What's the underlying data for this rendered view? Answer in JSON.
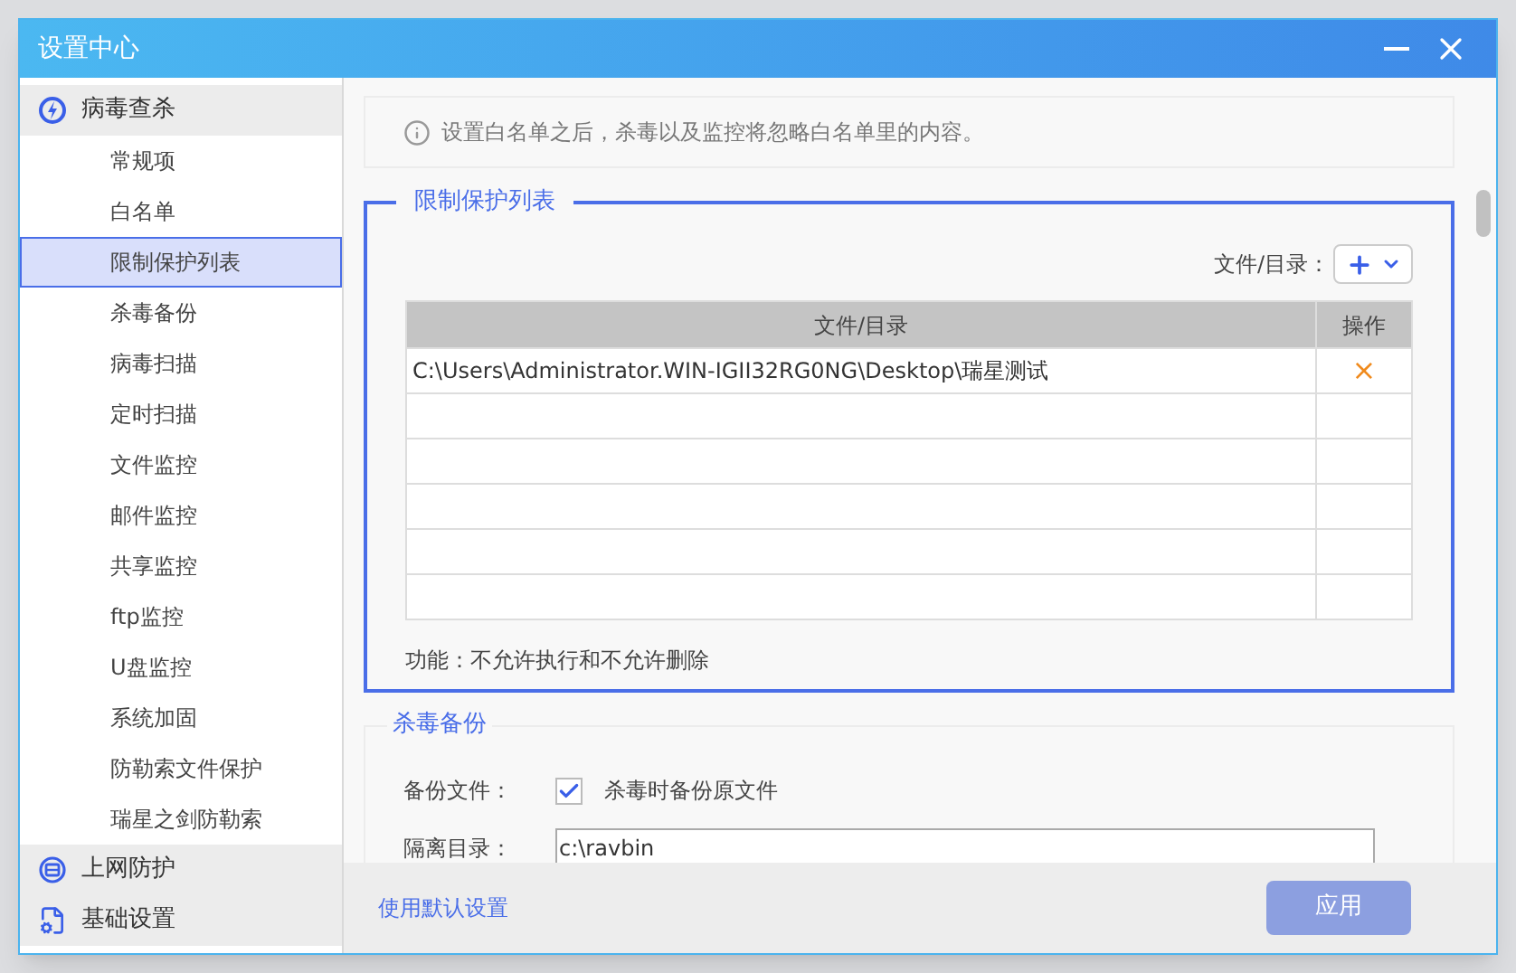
{
  "window": {
    "title": "设置中心"
  },
  "sidebar": {
    "groups": [
      {
        "label": "病毒查杀",
        "items": [
          {
            "label": "常规项",
            "selected": false
          },
          {
            "label": "白名单",
            "selected": false
          },
          {
            "label": "限制保护列表",
            "selected": true
          },
          {
            "label": "杀毒备份",
            "selected": false
          },
          {
            "label": "病毒扫描",
            "selected": false
          },
          {
            "label": "定时扫描",
            "selected": false
          },
          {
            "label": "文件监控",
            "selected": false
          },
          {
            "label": "邮件监控",
            "selected": false
          },
          {
            "label": "共享监控",
            "selected": false
          },
          {
            "label": "ftp监控",
            "selected": false
          },
          {
            "label": "U盘监控",
            "selected": false
          },
          {
            "label": "系统加固",
            "selected": false
          },
          {
            "label": "防勒索文件保护",
            "selected": false
          },
          {
            "label": "瑞星之剑防勒索",
            "selected": false
          }
        ]
      },
      {
        "label": "上网防护"
      },
      {
        "label": "基础设置"
      }
    ]
  },
  "notice": "设置白名单之后，杀毒以及监控将忽略白名单里的内容。",
  "protect_list": {
    "title": "限制保护列表",
    "add_label": "文件/目录：",
    "table": {
      "columns": [
        "文件/目录",
        "操作"
      ],
      "rows": [
        {
          "path": "C:\\Users\\Administrator.WIN-IGII32RG0NG\\Desktop\\瑞星测试",
          "action": "×"
        }
      ]
    },
    "note": "功能：不允许执行和不允许删除"
  },
  "backup": {
    "title": "杀毒备份",
    "rows": [
      {
        "kind": "checkbox",
        "label": "备份文件：",
        "text": "杀毒时备份原文件",
        "checked": true
      },
      {
        "kind": "field",
        "label": "隔离目录：",
        "value": "c:\\ravbin"
      }
    ]
  },
  "footer": {
    "link": "使用默认设置",
    "apply": "应用",
    "apply_disabled": true
  }
}
